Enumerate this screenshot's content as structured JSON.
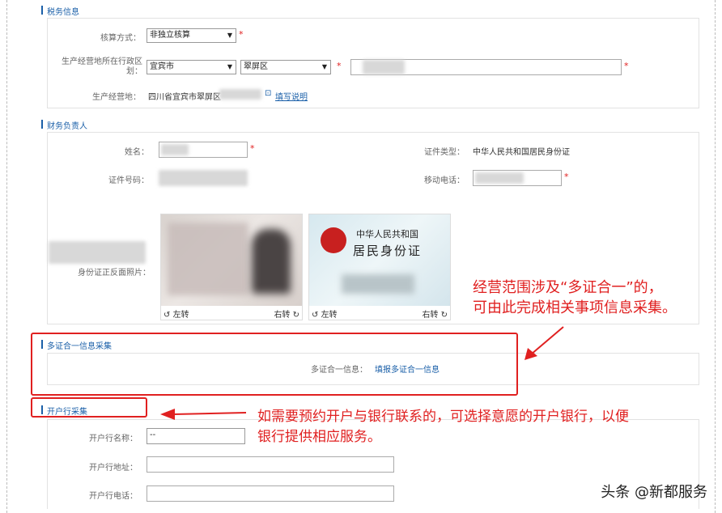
{
  "tax_section": {
    "title": "税务信息",
    "accounting_label": "核算方式：",
    "accounting_value": "非独立核算",
    "region_label": "生产经营地所在行政区划：",
    "city_value": "宜宾市",
    "district_value": "翠屏区",
    "address_label": "生产经营地：",
    "address_value": "四川省宜宾市翠屏区",
    "fill_help_link": "填写说明"
  },
  "finance_section": {
    "title": "财务负责人",
    "name_label": "姓名：",
    "cert_type_label": "证件类型：",
    "cert_type_value": "中华人民共和国居民身份证",
    "cert_no_label": "证件号码：",
    "mobile_label": "移动电话：",
    "photo_label": "身份证正反面照片：",
    "id_back_line1": "中华人民共和国",
    "id_back_line2": "居民身份证",
    "rotate_left": "左转",
    "rotate_right": "右转"
  },
  "multi_cert_section": {
    "title": "多证合一信息采集",
    "info_label": "多证合一信息：",
    "report_link": "填报多证合一信息"
  },
  "bank_section": {
    "title": "开户行采集",
    "bank_name_label": "开户行名称：",
    "bank_name_value": "--",
    "bank_address_label": "开户行地址：",
    "bank_phone_label": "开户行电话："
  },
  "annotations": {
    "multi_cert_line1": "经营范围涉及“多证合一”的，",
    "multi_cert_line2": "可由此完成相关事项信息采集。",
    "bank_line1": "如需要预约开户与银行联系的，可选择意愿的开户银行，以便",
    "bank_line2": "银行提供相应服务。"
  },
  "watermark": "头条 @新都服务",
  "required_mark": "*",
  "colors": {
    "accent": "#1a5fa8",
    "annotation": "#e02020"
  }
}
